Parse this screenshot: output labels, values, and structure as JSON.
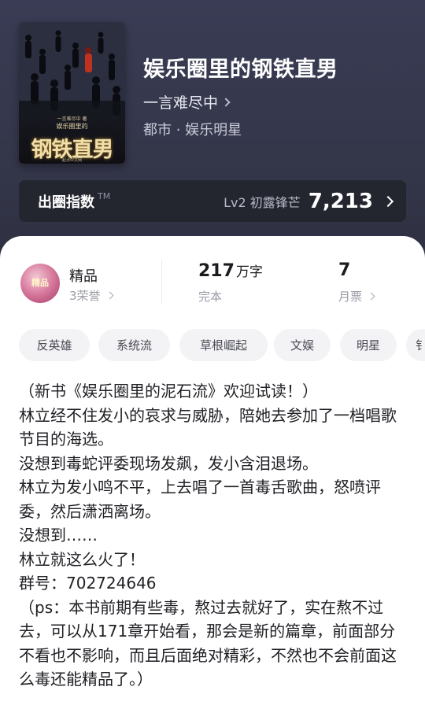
{
  "book": {
    "title": "娱乐圈里的钢铁直男",
    "author": "一言难尽中",
    "genre": "都市 · 娱乐明星",
    "cover": {
      "sub_text": "一言难尽中 著",
      "small_title": "娱乐圈里的",
      "big_title": "钢铁直男",
      "publisher": "起点中文网"
    }
  },
  "index": {
    "label": "出圈指数",
    "tm": "TM",
    "level": "Lv2 初露锋芒",
    "value": "7,213"
  },
  "stats": {
    "quality": {
      "title": "精品",
      "sub": "3荣誉",
      "badge_text": "精品"
    },
    "words": {
      "num": "217",
      "unit": "万字",
      "label": "完本"
    },
    "monthly_ticket": {
      "num": "7",
      "label": "月票"
    }
  },
  "tags": [
    "反英雄",
    "系统流",
    "草根崛起",
    "文娱",
    "明星",
    "钅"
  ],
  "description": [
    "（新书《娱乐圈里的泥石流》欢迎试读！）",
    "林立经不住发小的哀求与威胁，陪她去参加了一档唱歌节目的海选。",
    "没想到毒蛇评委现场发飙，发小含泪退场。",
    "林立为发小鸣不平，上去唱了一首毒舌歌曲，怒喷评委，然后潇洒离场。",
    "没想到……",
    "林立就这么火了！",
    "群号：702724646",
    "（ps：本书前期有些毒，熬过去就好了，实在熬不过去，可以从171章开始看，那会是新的篇章，前面部分不看也不影响，而且后面绝对精彩，不然也不会前面这么毒还能精品了。）"
  ]
}
